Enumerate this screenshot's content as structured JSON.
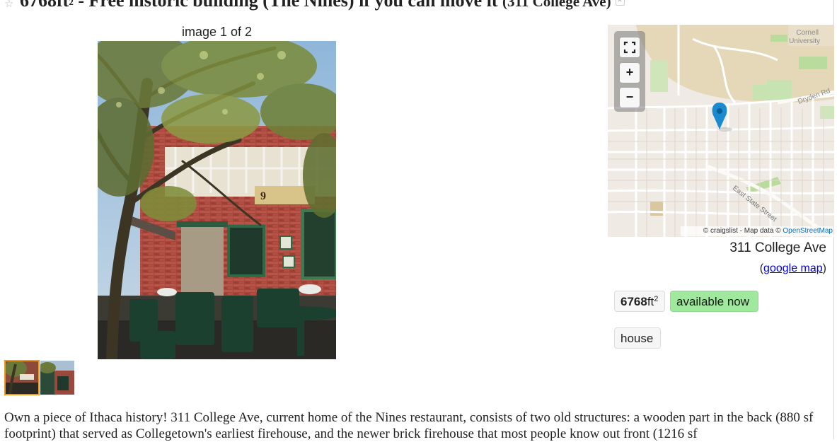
{
  "header": {
    "title_main": "6768ft",
    "title_sup": "2",
    "title_rest": " - Free historic building (The Nines) if you can move it ",
    "title_location": "(311 College Ave)",
    "hide_glyph": "✕",
    "star_icon": "star-icon"
  },
  "gallery": {
    "counter": "image 1 of 2",
    "thumbnail_count": 2,
    "selected_index": 1,
    "selected_border_color": "#f2961c"
  },
  "map": {
    "labels": {
      "university": "Cornell\nUniversity",
      "dryden": "Dryden Rd",
      "street": "East State Street"
    },
    "attribution_prefix": "© craigslist - Map data © ",
    "attribution_link": "OpenStreetMap",
    "controls": {
      "zoom_in": "+",
      "zoom_out": "−",
      "fullscreen_icon": "fullscreen-icon"
    },
    "marker_color": "#1a8bd0"
  },
  "location": {
    "address": "311 College Ave",
    "google_map_open": "(",
    "google_map_label": "google map",
    "google_map_close": ")"
  },
  "attributes": {
    "sqft_value": "6768",
    "sqft_unit": "ft",
    "sqft_sup": "2",
    "availability": "available now",
    "housing_type": "house",
    "availability_color": "#9fe89d"
  },
  "body": {
    "text": "Own a piece of Ithaca history! 311 College Ave, current home of the Nines restaurant, consists of two old structures: a wooden part in the back (880 sf footprint) that served as Collegetown's earliest firehouse, and the newer brick firehouse that most people know out front (1216 sf"
  }
}
